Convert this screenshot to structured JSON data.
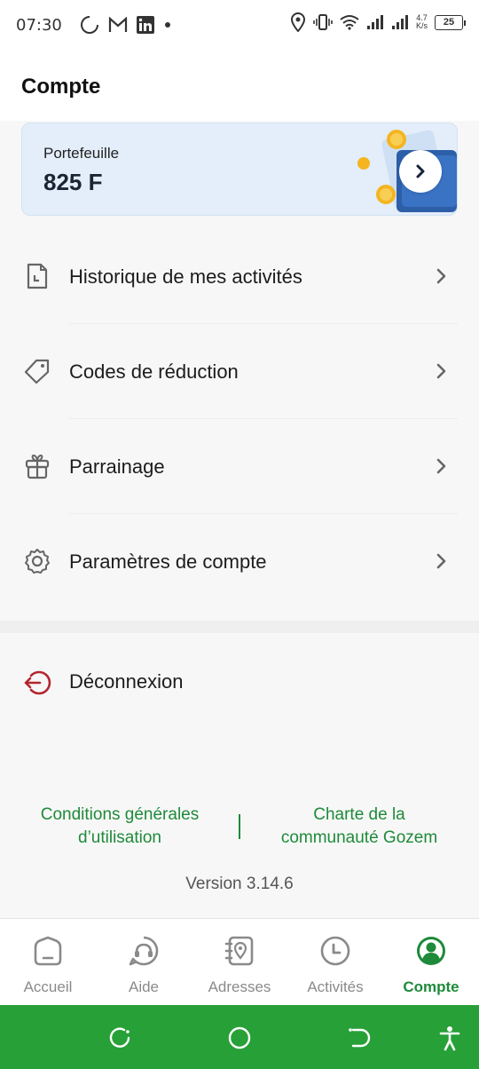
{
  "status": {
    "time": "07:30",
    "speed_top": "4.7",
    "speed_bottom": "K/s",
    "battery": "25"
  },
  "header": {
    "title": "Compte"
  },
  "wallet": {
    "label": "Portefeuille",
    "amount": "825 F"
  },
  "menu": {
    "items": [
      {
        "label": "Historique de mes activités",
        "icon": "document-icon"
      },
      {
        "label": "Codes de réduction",
        "icon": "tag-icon"
      },
      {
        "label": "Parrainage",
        "icon": "gift-icon"
      },
      {
        "label": "Paramètres de compte",
        "icon": "gear-icon"
      }
    ]
  },
  "logout": {
    "label": "Déconnexion",
    "icon": "logout-icon",
    "color": "#b3262e"
  },
  "links": {
    "terms_line1": "Conditions générales",
    "terms_line2": "d’utilisation",
    "charter_line1": "Charte de la",
    "charter_line2": "communauté Gozem",
    "color": "#1e8a3a"
  },
  "version": "Version 3.14.6",
  "tabs": [
    {
      "label": "Accueil",
      "icon": "home-icon"
    },
    {
      "label": "Aide",
      "icon": "chat-help-icon"
    },
    {
      "label": "Adresses",
      "icon": "address-book-icon"
    },
    {
      "label": "Activités",
      "icon": "clock-icon"
    },
    {
      "label": "Compte",
      "icon": "account-icon",
      "active": true
    }
  ],
  "colors": {
    "accent": "#1e8a3a",
    "navbar": "#27a037",
    "wallet_bg": "#e3eefa"
  }
}
